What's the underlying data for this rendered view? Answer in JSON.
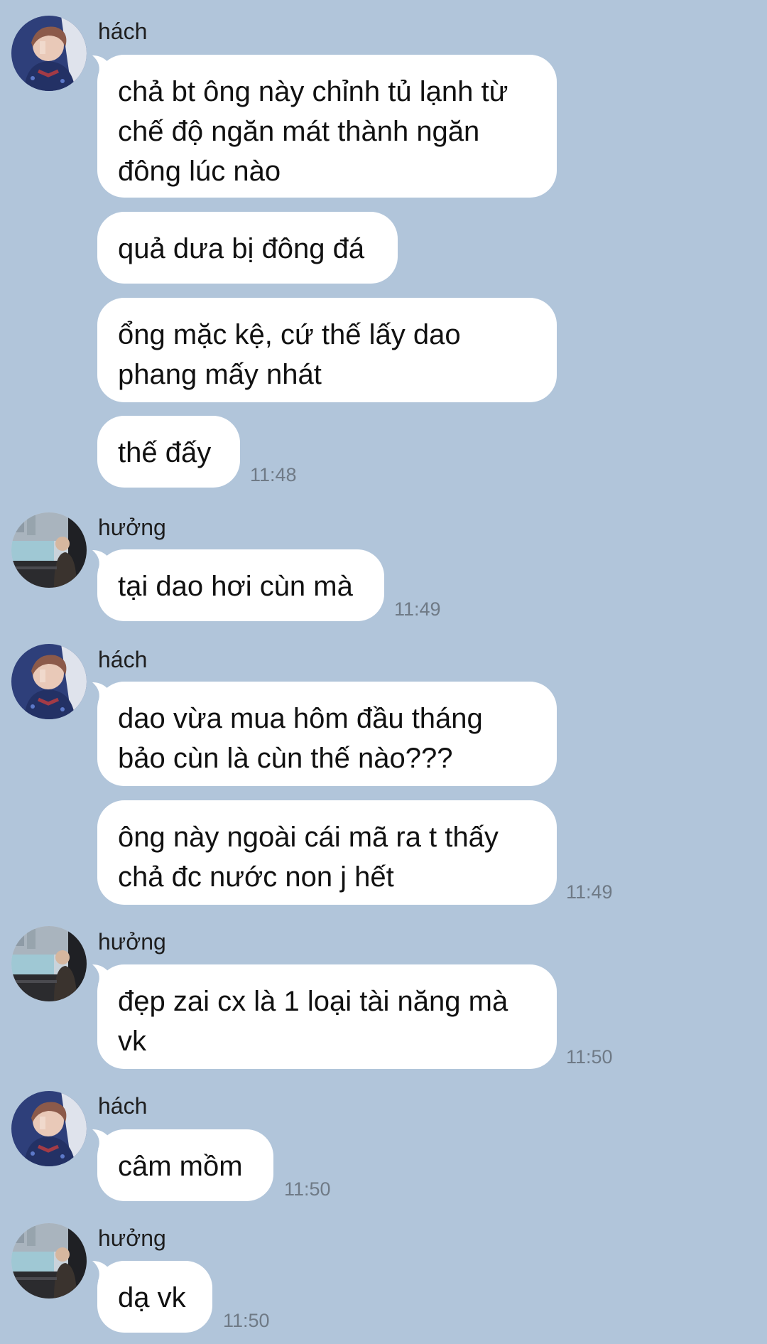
{
  "messages": [
    {
      "sender": "hách",
      "text": "chả bt ông này chỉnh tủ lạnh từ\nchế độ ngăn mát thành ngăn\nđông lúc nào",
      "time": ""
    },
    {
      "sender": "",
      "text": "quả dưa bị đông đá",
      "time": ""
    },
    {
      "sender": "",
      "text": "ổng mặc kệ, cứ thế lấy dao\nphang mấy nhát",
      "time": ""
    },
    {
      "sender": "",
      "text": "thế đấy",
      "time": "11:48"
    },
    {
      "sender": "hưởng",
      "text": "tại dao hơi cùn mà",
      "time": "11:49"
    },
    {
      "sender": "hách",
      "text": "dao vừa mua hôm đầu tháng\nbảo cùn là cùn thế nào???",
      "time": ""
    },
    {
      "sender": "",
      "text": "ông này ngoài cái mã ra t thấy\nchả đc nước non j hết",
      "time": "11:49"
    },
    {
      "sender": "hưởng",
      "text": "đẹp zai cx là 1 loại tài năng mà\nvk",
      "time": "11:50"
    },
    {
      "sender": "hách",
      "text": "câm mồm",
      "time": "11:50"
    },
    {
      "sender": "hưởng",
      "text": "dạ vk",
      "time": "11:50"
    }
  ],
  "colors": {
    "background": "#b1c5da",
    "bubble": "#ffffff",
    "timestamp": "#6f7a86"
  },
  "icons": {
    "hach_avatar": "profile-photo-hach",
    "huong_avatar": "profile-photo-huong"
  }
}
